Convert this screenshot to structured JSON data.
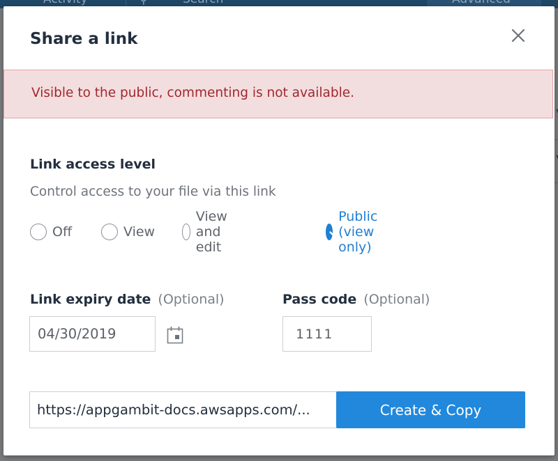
{
  "background": {
    "tabs": [
      "Activity",
      "Search",
      "Advanced"
    ]
  },
  "modal": {
    "title": "Share a link",
    "alert": "Visible to the public, commenting is not available.",
    "access": {
      "title": "Link access level",
      "description": "Control access to your file via this link",
      "options": [
        "Off",
        "View",
        "View and edit",
        "Public (view only)"
      ],
      "selected": "Public (view only)"
    },
    "expiry": {
      "label": "Link expiry date",
      "optional": "(Optional)",
      "value": "04/30/2019"
    },
    "passcode": {
      "label": "Pass code",
      "optional": "(Optional)",
      "value": "1111"
    },
    "url": {
      "value": "https://appgambit-docs.awsapps.com/..."
    },
    "create_button": "Create & Copy"
  },
  "colors": {
    "accent": "#2188dc",
    "alert_bg": "#f3dedf",
    "alert_text": "#a2272e",
    "title": "#232f3e"
  },
  "icons": [
    "close-icon",
    "check-icon",
    "calendar-icon",
    "search-icon"
  ]
}
